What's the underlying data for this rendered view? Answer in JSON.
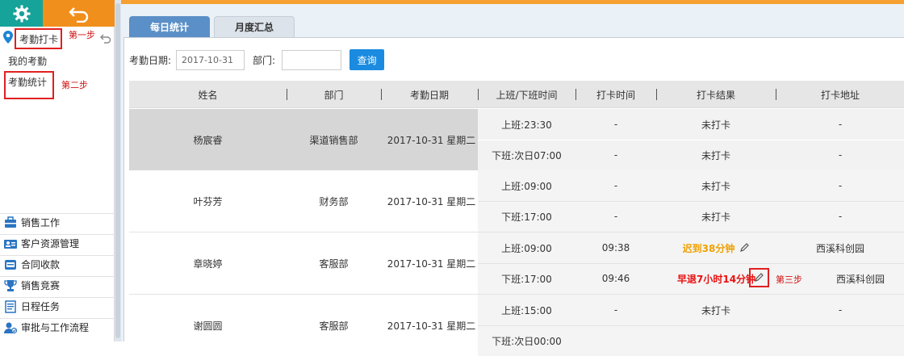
{
  "sidebar": {
    "checkin_label": "考勤打卡",
    "step1": "第一步",
    "my_attendance": "我的考勤",
    "attendance_stats": "考勤统计",
    "step2": "第二步",
    "menu": [
      {
        "label": "销售工作",
        "icon": "sales-work-icon"
      },
      {
        "label": "客户资源管理",
        "icon": "customer-icon"
      },
      {
        "label": "合同收款",
        "icon": "contract-icon"
      },
      {
        "label": "销售竞赛",
        "icon": "trophy-icon"
      },
      {
        "label": "日程任务",
        "icon": "schedule-icon"
      },
      {
        "label": "审批与工作流程",
        "icon": "approval-icon"
      }
    ]
  },
  "tabs": {
    "daily": "每日统计",
    "monthly": "月度汇总"
  },
  "filter": {
    "date_label": "考勤日期:",
    "date_value": "2017-10-31",
    "dept_label": "部门:",
    "dept_value": "",
    "query": "查询"
  },
  "table": {
    "headers": [
      "姓名",
      "部门",
      "考勤日期",
      "上班/下班时间",
      "打卡时间",
      "打卡结果",
      "打卡地址"
    ],
    "groups": [
      {
        "name": "杨宸睿",
        "dept": "渠道销售部",
        "date": "2017-10-31 星期二",
        "rows": [
          {
            "shift": "上班:23:30",
            "time": "-",
            "result": "未打卡",
            "addr": "-"
          },
          {
            "shift": "下班:次日07:00",
            "time": "-",
            "result": "未打卡",
            "addr": "-"
          }
        ]
      },
      {
        "name": "叶芬芳",
        "dept": "财务部",
        "date": "2017-10-31 星期二",
        "rows": [
          {
            "shift": "上班:09:00",
            "time": "-",
            "result": "未打卡",
            "addr": "-"
          },
          {
            "shift": "下班:17:00",
            "time": "-",
            "result": "未打卡",
            "addr": "-"
          }
        ]
      },
      {
        "name": "章晓婷",
        "dept": "客服部",
        "date": "2017-10-31 星期二",
        "rows": [
          {
            "shift": "上班:09:00",
            "time": "09:38",
            "result": "迟到38分钟",
            "addr": "西溪科创园"
          },
          {
            "shift": "下班:17:00",
            "time": "09:46",
            "result": "早退7小时14分钟",
            "addr": "西溪科创园"
          }
        ]
      },
      {
        "name": "谢圆圆",
        "dept": "客服部",
        "date": "2017-10-31 星期二",
        "rows": [
          {
            "shift": "上班:15:00",
            "time": "-",
            "result": "未打卡",
            "addr": "-"
          },
          {
            "shift": "下班:次日00:00",
            "time": "",
            "result": "",
            "addr": ""
          }
        ]
      }
    ],
    "step3": "第三步"
  },
  "colors": {
    "teal": "#16a39a",
    "orange": "#f08f1c",
    "blue": "#1a8be0",
    "late": "#f0a000",
    "early": "#e81010",
    "annotation": "#e02020"
  }
}
